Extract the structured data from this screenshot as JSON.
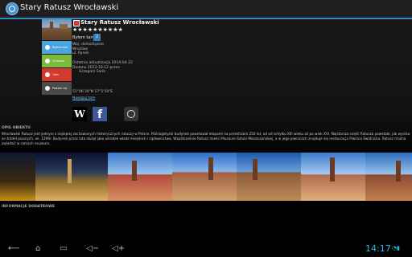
{
  "actionbar": {
    "title": "Stary Ratusz Wrocławski",
    "app_icon": "search-globe-icon",
    "accent": "#2f8fc4"
  },
  "place": {
    "title": "Stary Ratusz Wrocławski",
    "stars": "★★★★★★★★★★",
    "been_label": "Byłem tam",
    "been_count": "2",
    "address": [
      "Woj. dolnośląskie",
      "Wrocław",
      "ul. Rynek"
    ],
    "updated": "Ostatnia aktualizacja 2014-04-22",
    "added_line1": "Dodano 2013-10-12 przez",
    "added_line2": "Grzegorz Sarik",
    "coords": "51°06'34\"N 17°1'50\"E",
    "map_link": "Nawiguj tam"
  },
  "buttons": {
    "been": "Byłem tam",
    "favorite": "Ulubione",
    "description": "Opis",
    "share": "Podziel się",
    "colors": {
      "been": "#49a6dc",
      "favorite": "#7cb83a",
      "description": "#d33a2e",
      "share": "#4a4a4a"
    }
  },
  "links": {
    "wiki": "W",
    "facebook": "f"
  },
  "description": {
    "heading": "OPIS OBIEKTU",
    "text": "Wrocławski Ratusz jest jednym z najlepiej zachowanych historycznych ratuszy w Polsce. Późnogotycki budynek powstawał etapami na przestrzeni 250 lat, od od schyłku XIII wieku aż po wiek XVI. Najstarsza część Ratusza powstała, jak wynika ze źródeł pisanych, ok. 1299r. Budynek przez lata służył jako ośrodek władz miejskich i sądownictwa. Współcześnie Ratusz mieści Muzeum Sztuki Mieszczańskiej, a w jego piwnicach znajduje się restauracja Piwnica Świdnicka. Ratusz można zwiedzić w ramach muzeum."
  },
  "additional": {
    "heading": "INFORMACJE DODATKOWE"
  },
  "navbar": {
    "time": "14:17"
  }
}
